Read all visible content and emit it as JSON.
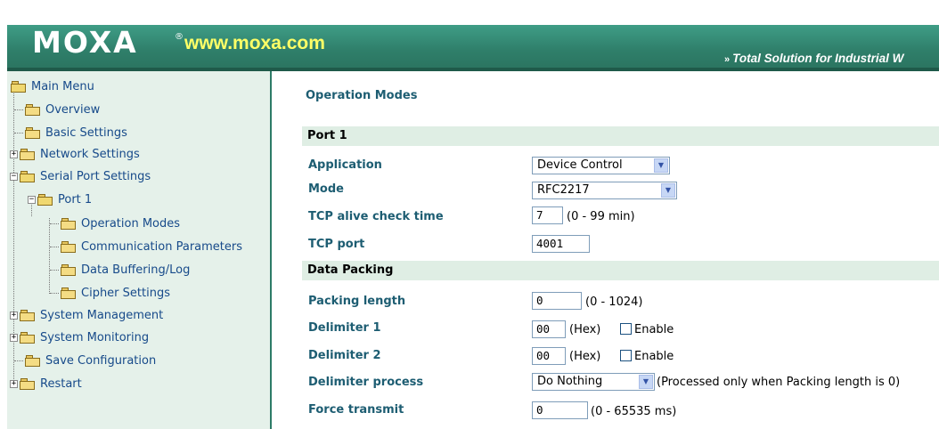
{
  "header": {
    "logo": "MOXA",
    "logo_mark": "®",
    "url": "www.moxa.com",
    "tagline_chevron": "»",
    "tagline": "Total Solution for Industrial W"
  },
  "sidebar": {
    "main_menu": "Main Menu",
    "overview": "Overview",
    "basic_settings": "Basic Settings",
    "network_settings": "Network Settings",
    "serial_port_settings": "Serial Port Settings",
    "port1": "Port 1",
    "operation_modes": "Operation Modes",
    "communication_parameters": "Communication Parameters",
    "data_buffering": "Data Buffering/Log",
    "cipher_settings": "Cipher Settings",
    "system_management": "System Management",
    "system_monitoring": "System Monitoring",
    "save_configuration": "Save Configuration",
    "restart": "Restart"
  },
  "main": {
    "title": "Operation Modes",
    "port_section": "Port 1",
    "application_label": "Application",
    "application_value": "Device Control",
    "mode_label": "Mode",
    "mode_value": "RFC2217",
    "tcp_alive_label": "TCP alive check time",
    "tcp_alive_value": "7",
    "tcp_alive_hint": "(0 - 99 min)",
    "tcp_port_label": "TCP port",
    "tcp_port_value": "4001",
    "packing_section": "Data Packing",
    "packing_length_label": "Packing length",
    "packing_length_value": "0",
    "packing_length_hint": "(0 - 1024)",
    "delim1_label": "Delimiter 1",
    "delim1_value": "00",
    "delim1_hex": "(Hex)",
    "delim1_enable": "Enable",
    "delim2_label": "Delimiter 2",
    "delim2_value": "00",
    "delim2_hex": "(Hex)",
    "delim2_enable": "Enable",
    "delim_process_label": "Delimiter process",
    "delim_process_value": "Do Nothing",
    "delim_process_hint": "(Processed only when Packing length is 0)",
    "force_transmit_label": "Force transmit",
    "force_transmit_value": "0",
    "force_transmit_hint": "(0 - 65535 ms)"
  },
  "colors": {
    "header_green": "#2f7f6a",
    "url_yellow": "#ffff66",
    "sidebar_bg": "#e5f1ea",
    "label_blue": "#1d5d72",
    "section_bg": "#dfeee4"
  }
}
